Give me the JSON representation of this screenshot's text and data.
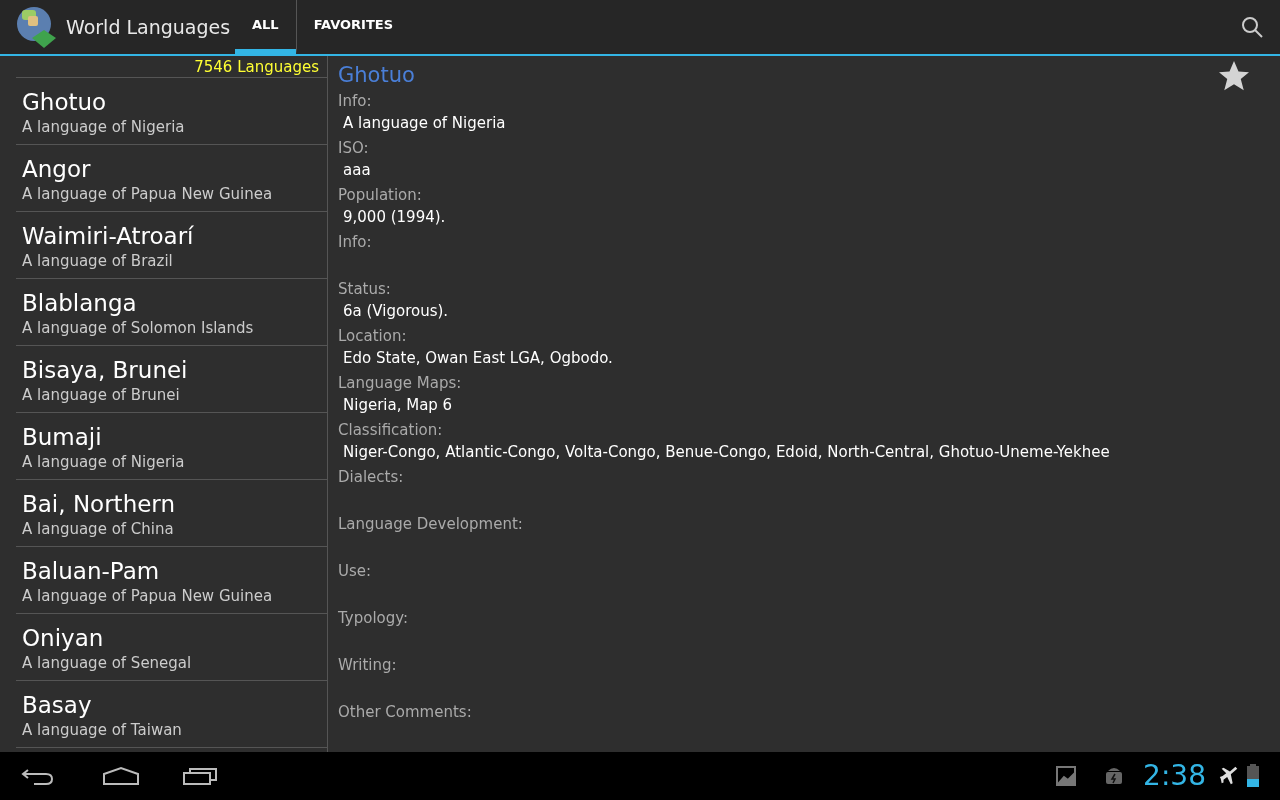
{
  "app": {
    "title": "World Languages"
  },
  "tabs": [
    {
      "label": "ALL",
      "selected": true
    },
    {
      "label": "FAVORITES",
      "selected": false
    }
  ],
  "list": {
    "count": "7546 Languages",
    "items": [
      {
        "name": "Ghotuo",
        "description": "A language of Nigeria"
      },
      {
        "name": "Angor",
        "description": "A language of Papua New Guinea"
      },
      {
        "name": "Waimiri-Atroarí",
        "description": "A language of Brazil"
      },
      {
        "name": "Blablanga",
        "description": "A language of Solomon Islands"
      },
      {
        "name": "Bisaya, Brunei",
        "description": "A language of Brunei"
      },
      {
        "name": "Bumaji",
        "description": "A language of Nigeria"
      },
      {
        "name": "Bai, Northern",
        "description": "A language of China"
      },
      {
        "name": "Baluan-Pam",
        "description": "A language of Papua New Guinea"
      },
      {
        "name": "Oniyan",
        "description": "A language of Senegal"
      },
      {
        "name": "Basay",
        "description": "A language of Taiwan"
      }
    ]
  },
  "detail": {
    "title": "Ghotuo",
    "favorite": false,
    "fields": [
      {
        "label": "Info:",
        "value": "A language of Nigeria"
      },
      {
        "label": "ISO:",
        "value": "aaa"
      },
      {
        "label": "Population:",
        "value": "9,000 (1994)."
      },
      {
        "label": "Info:"
      },
      {
        "label": "Status:",
        "value": "6a (Vigorous)."
      },
      {
        "label": "Location:",
        "value": "Edo State, Owan East LGA, Ogbodo."
      },
      {
        "label": "Language Maps:",
        "value": "Nigeria, Map 6"
      },
      {
        "label": "Classification:",
        "value": "Niger-Congo, Atlantic-Congo, Volta-Congo, Benue-Congo, Edoid, North-Central, Ghotuo-Uneme-Yekhee"
      },
      {
        "label": "Dialects:"
      },
      {
        "label": "Language Development:"
      },
      {
        "label": "Use:"
      },
      {
        "label": "Typology:"
      },
      {
        "label": "Writing:"
      },
      {
        "label": "Other Comments:"
      }
    ]
  },
  "status_bar": {
    "time": "2:38"
  }
}
